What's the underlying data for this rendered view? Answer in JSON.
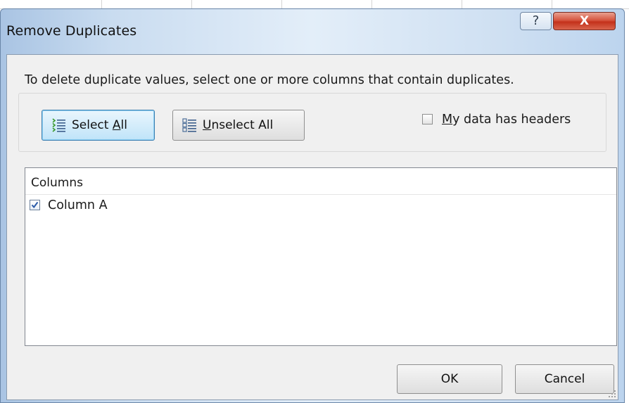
{
  "dialog": {
    "title": "Remove Duplicates",
    "help_button": "?",
    "close_button": "X"
  },
  "instructions": "To delete duplicate values, select one or more columns that contain duplicates.",
  "buttons": {
    "select_all": {
      "prefix": "Select ",
      "mnemonic": "A",
      "suffix": "ll"
    },
    "unselect_all": {
      "prefix": "",
      "mnemonic": "U",
      "suffix": "nselect All"
    },
    "ok": "OK",
    "cancel": "Cancel"
  },
  "headers_checkbox": {
    "mnemonic": "M",
    "rest": "y data has headers",
    "checked": false
  },
  "columns_list": {
    "header": "Columns",
    "items": [
      {
        "label": "Column A",
        "checked": true
      }
    ]
  },
  "colors": {
    "title_bar": "#c9dcf0",
    "close_button": "#c4311b",
    "select_all_highlight": "#bfe4f9",
    "checkmark": "#2a5aa8"
  },
  "icons": {
    "select_all": "select-all-list-icon",
    "unselect_all": "unselect-all-list-icon",
    "resize": "resize-grip-icon"
  }
}
